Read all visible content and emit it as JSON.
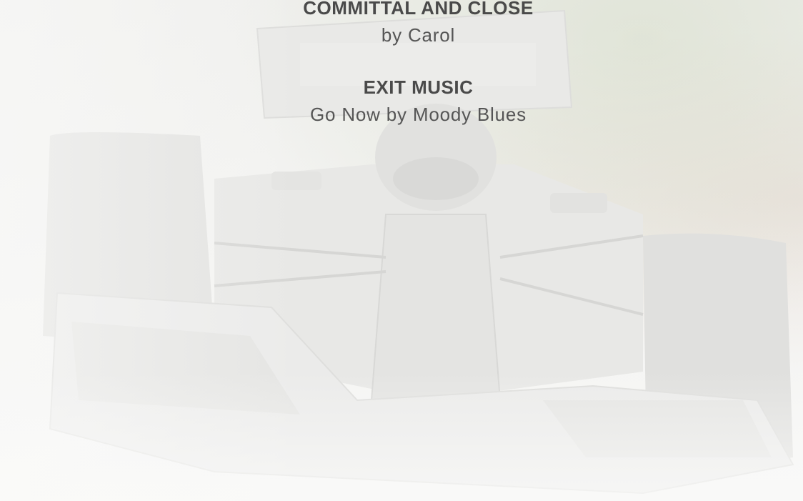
{
  "sections": [
    {
      "title": "COMMITTAL AND CLOSE",
      "detail": "by Carol"
    },
    {
      "title": "EXIT MUSIC",
      "detail": "Go Now by Moody Blues"
    }
  ],
  "background": {
    "subject": "race-car-image",
    "tint": "#f3f3f1"
  }
}
